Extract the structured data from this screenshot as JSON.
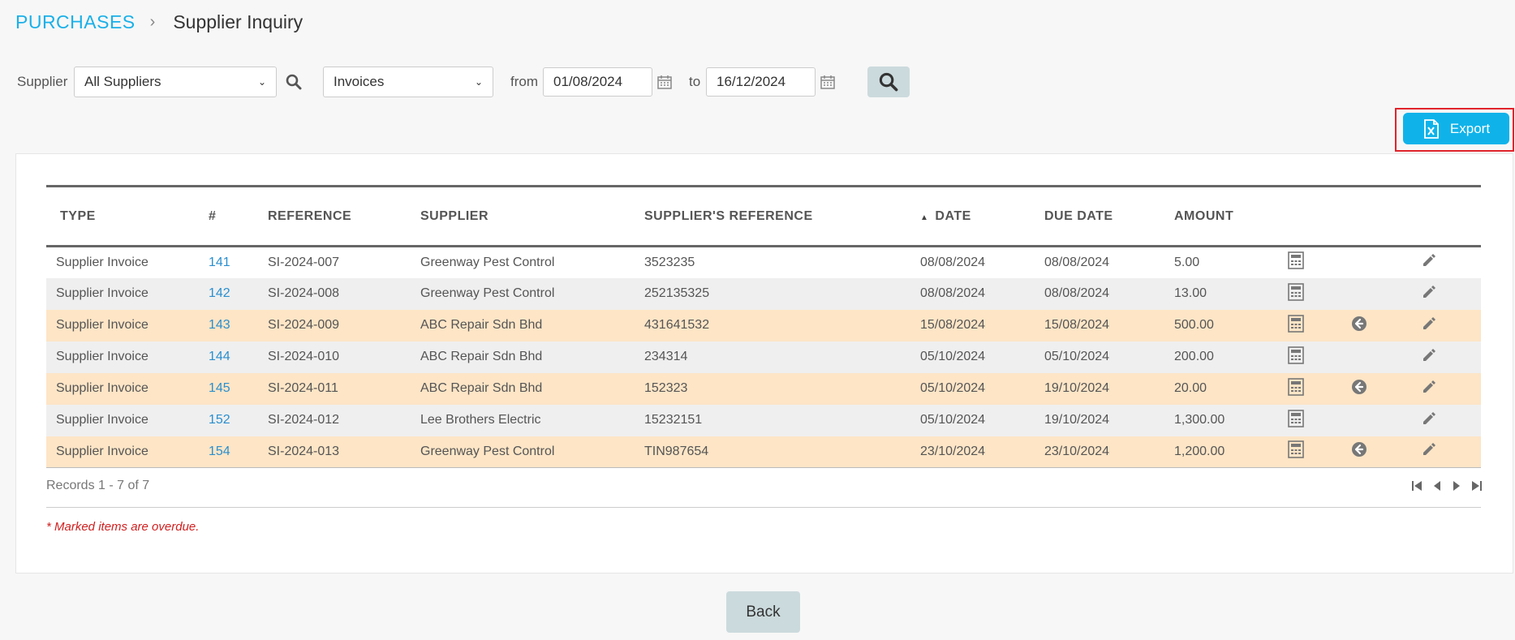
{
  "breadcrumb": {
    "root": "PURCHASES",
    "separator": "›",
    "page": "Supplier Inquiry"
  },
  "filters": {
    "supplier_label": "Supplier",
    "supplier_value": "All Suppliers",
    "type_value": "Invoices",
    "from_label": "from",
    "from_value": "01/08/2024",
    "to_label": "to",
    "to_value": "16/12/2024"
  },
  "export": {
    "label": "Export"
  },
  "table": {
    "headers": {
      "type": "TYPE",
      "num": "#",
      "reference": "REFERENCE",
      "supplier": "SUPPLIER",
      "supplier_ref": "SUPPLIER'S REFERENCE",
      "date": "DATE",
      "due_date": "DUE DATE",
      "amount": "AMOUNT"
    },
    "rows": [
      {
        "type": "Supplier Invoice",
        "num": "141",
        "reference": "SI-2024-007",
        "supplier": "Greenway Pest Control",
        "supplier_ref": "3523235",
        "date": "08/08/2024",
        "due_date": "08/08/2024",
        "amount": "5.00",
        "highlight": false,
        "has_return": false
      },
      {
        "type": "Supplier Invoice",
        "num": "142",
        "reference": "SI-2024-008",
        "supplier": "Greenway Pest Control",
        "supplier_ref": "252135325",
        "date": "08/08/2024",
        "due_date": "08/08/2024",
        "amount": "13.00",
        "highlight": false,
        "has_return": false
      },
      {
        "type": "Supplier Invoice",
        "num": "143",
        "reference": "SI-2024-009",
        "supplier": "ABC Repair Sdn Bhd",
        "supplier_ref": "431641532",
        "date": "15/08/2024",
        "due_date": "15/08/2024",
        "amount": "500.00",
        "highlight": true,
        "has_return": true
      },
      {
        "type": "Supplier Invoice",
        "num": "144",
        "reference": "SI-2024-010",
        "supplier": "ABC Repair Sdn Bhd",
        "supplier_ref": "234314",
        "date": "05/10/2024",
        "due_date": "05/10/2024",
        "amount": "200.00",
        "highlight": false,
        "has_return": false
      },
      {
        "type": "Supplier Invoice",
        "num": "145",
        "reference": "SI-2024-011",
        "supplier": "ABC Repair Sdn Bhd",
        "supplier_ref": "152323",
        "date": "05/10/2024",
        "due_date": "19/10/2024",
        "amount": "20.00",
        "highlight": true,
        "has_return": true
      },
      {
        "type": "Supplier Invoice",
        "num": "152",
        "reference": "SI-2024-012",
        "supplier": "Lee Brothers Electric",
        "supplier_ref": "15232151",
        "date": "05/10/2024",
        "due_date": "19/10/2024",
        "amount": "1,300.00",
        "highlight": false,
        "has_return": false
      },
      {
        "type": "Supplier Invoice",
        "num": "154",
        "reference": "SI-2024-013",
        "supplier": "Greenway Pest Control",
        "supplier_ref": "TIN987654",
        "date": "23/10/2024",
        "due_date": "23/10/2024",
        "amount": "1,200.00",
        "highlight": true,
        "has_return": true
      }
    ],
    "records_text": "Records 1 - 7 of 7"
  },
  "overdue_note": "* Marked items are overdue.",
  "back": {
    "label": "Back"
  },
  "colors": {
    "accent": "#0fb3ea",
    "link": "#2a8fcf",
    "highlight_row": "#fde5c6",
    "overdue": "#d02020"
  },
  "icons": {
    "row_actions": [
      "calculator-icon",
      "return-arrow-icon",
      "pencil-icon"
    ],
    "pager": [
      "first-page-icon",
      "prev-page-icon",
      "next-page-icon",
      "last-page-icon"
    ]
  }
}
